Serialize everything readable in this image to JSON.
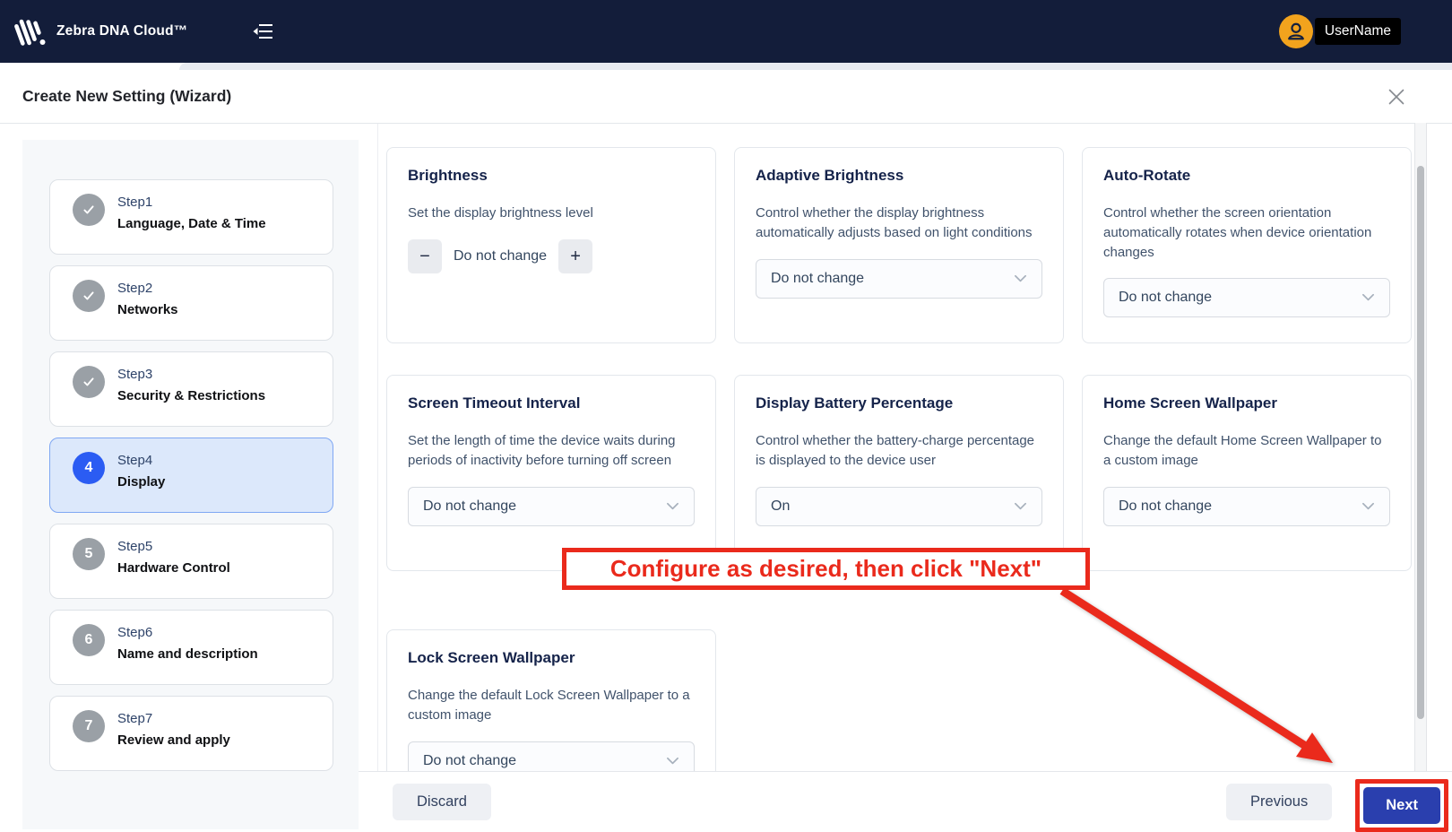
{
  "header": {
    "app_title": "Zebra DNA Cloud™",
    "username": "UserName"
  },
  "modal": {
    "title": "Create New Setting (Wizard)"
  },
  "wizard": {
    "steps": [
      {
        "label": "Step1",
        "title": "Language, Date & Time",
        "state": "completed"
      },
      {
        "label": "Step2",
        "title": "Networks",
        "state": "completed"
      },
      {
        "label": "Step3",
        "title": "Security & Restrictions",
        "state": "completed"
      },
      {
        "label": "Step4",
        "title": "Display",
        "state": "active",
        "number": "4"
      },
      {
        "label": "Step5",
        "title": "Hardware Control",
        "state": "upcoming",
        "number": "5"
      },
      {
        "label": "Step6",
        "title": "Name and description",
        "state": "upcoming",
        "number": "6"
      },
      {
        "label": "Step7",
        "title": "Review and apply",
        "state": "upcoming",
        "number": "7"
      }
    ]
  },
  "settings_cards": [
    {
      "title": "Brightness",
      "description": "Set the display brightness level",
      "control": "stepper",
      "value": "Do not change"
    },
    {
      "title": "Adaptive Brightness",
      "description": "Control whether the display brightness automatically adjusts based on light conditions",
      "control": "dropdown",
      "value": "Do not change"
    },
    {
      "title": "Auto-Rotate",
      "description": "Control whether the screen orientation automatically rotates when device orientation changes",
      "control": "dropdown",
      "value": "Do not change"
    },
    {
      "title": "Screen Timeout Interval",
      "description": "Set the length of time the device waits during periods of inactivity before turning off screen",
      "control": "dropdown",
      "value": "Do not change"
    },
    {
      "title": "Display Battery Percentage",
      "description": "Control whether the battery-charge percentage is displayed to the device user",
      "control": "dropdown",
      "value": "On"
    },
    {
      "title": "Home Screen Wallpaper",
      "description": "Change the default Home Screen Wallpaper to a custom image",
      "control": "dropdown",
      "value": "Do not change"
    },
    {
      "title": "Lock Screen Wallpaper",
      "description": "Change the default Lock Screen Wallpaper to a custom image",
      "control": "dropdown",
      "value": "Do not change"
    }
  ],
  "controls": {
    "stepper_minus": "−",
    "stepper_plus": "+"
  },
  "footer": {
    "discard_label": "Discard",
    "previous_label": "Previous",
    "next_label": "Next"
  },
  "annotation": {
    "text": "Configure as desired, then click \"Next\""
  },
  "colors": {
    "header_bg": "#131d3a",
    "accent_blue": "#2b5cf3",
    "active_step_bg": "#dce8fb",
    "completed_gray": "#9aa0a6",
    "next_button_blue": "#2a3fae",
    "annotation_red": "#ea2a1c",
    "avatar_orange": "#f2a31d"
  }
}
